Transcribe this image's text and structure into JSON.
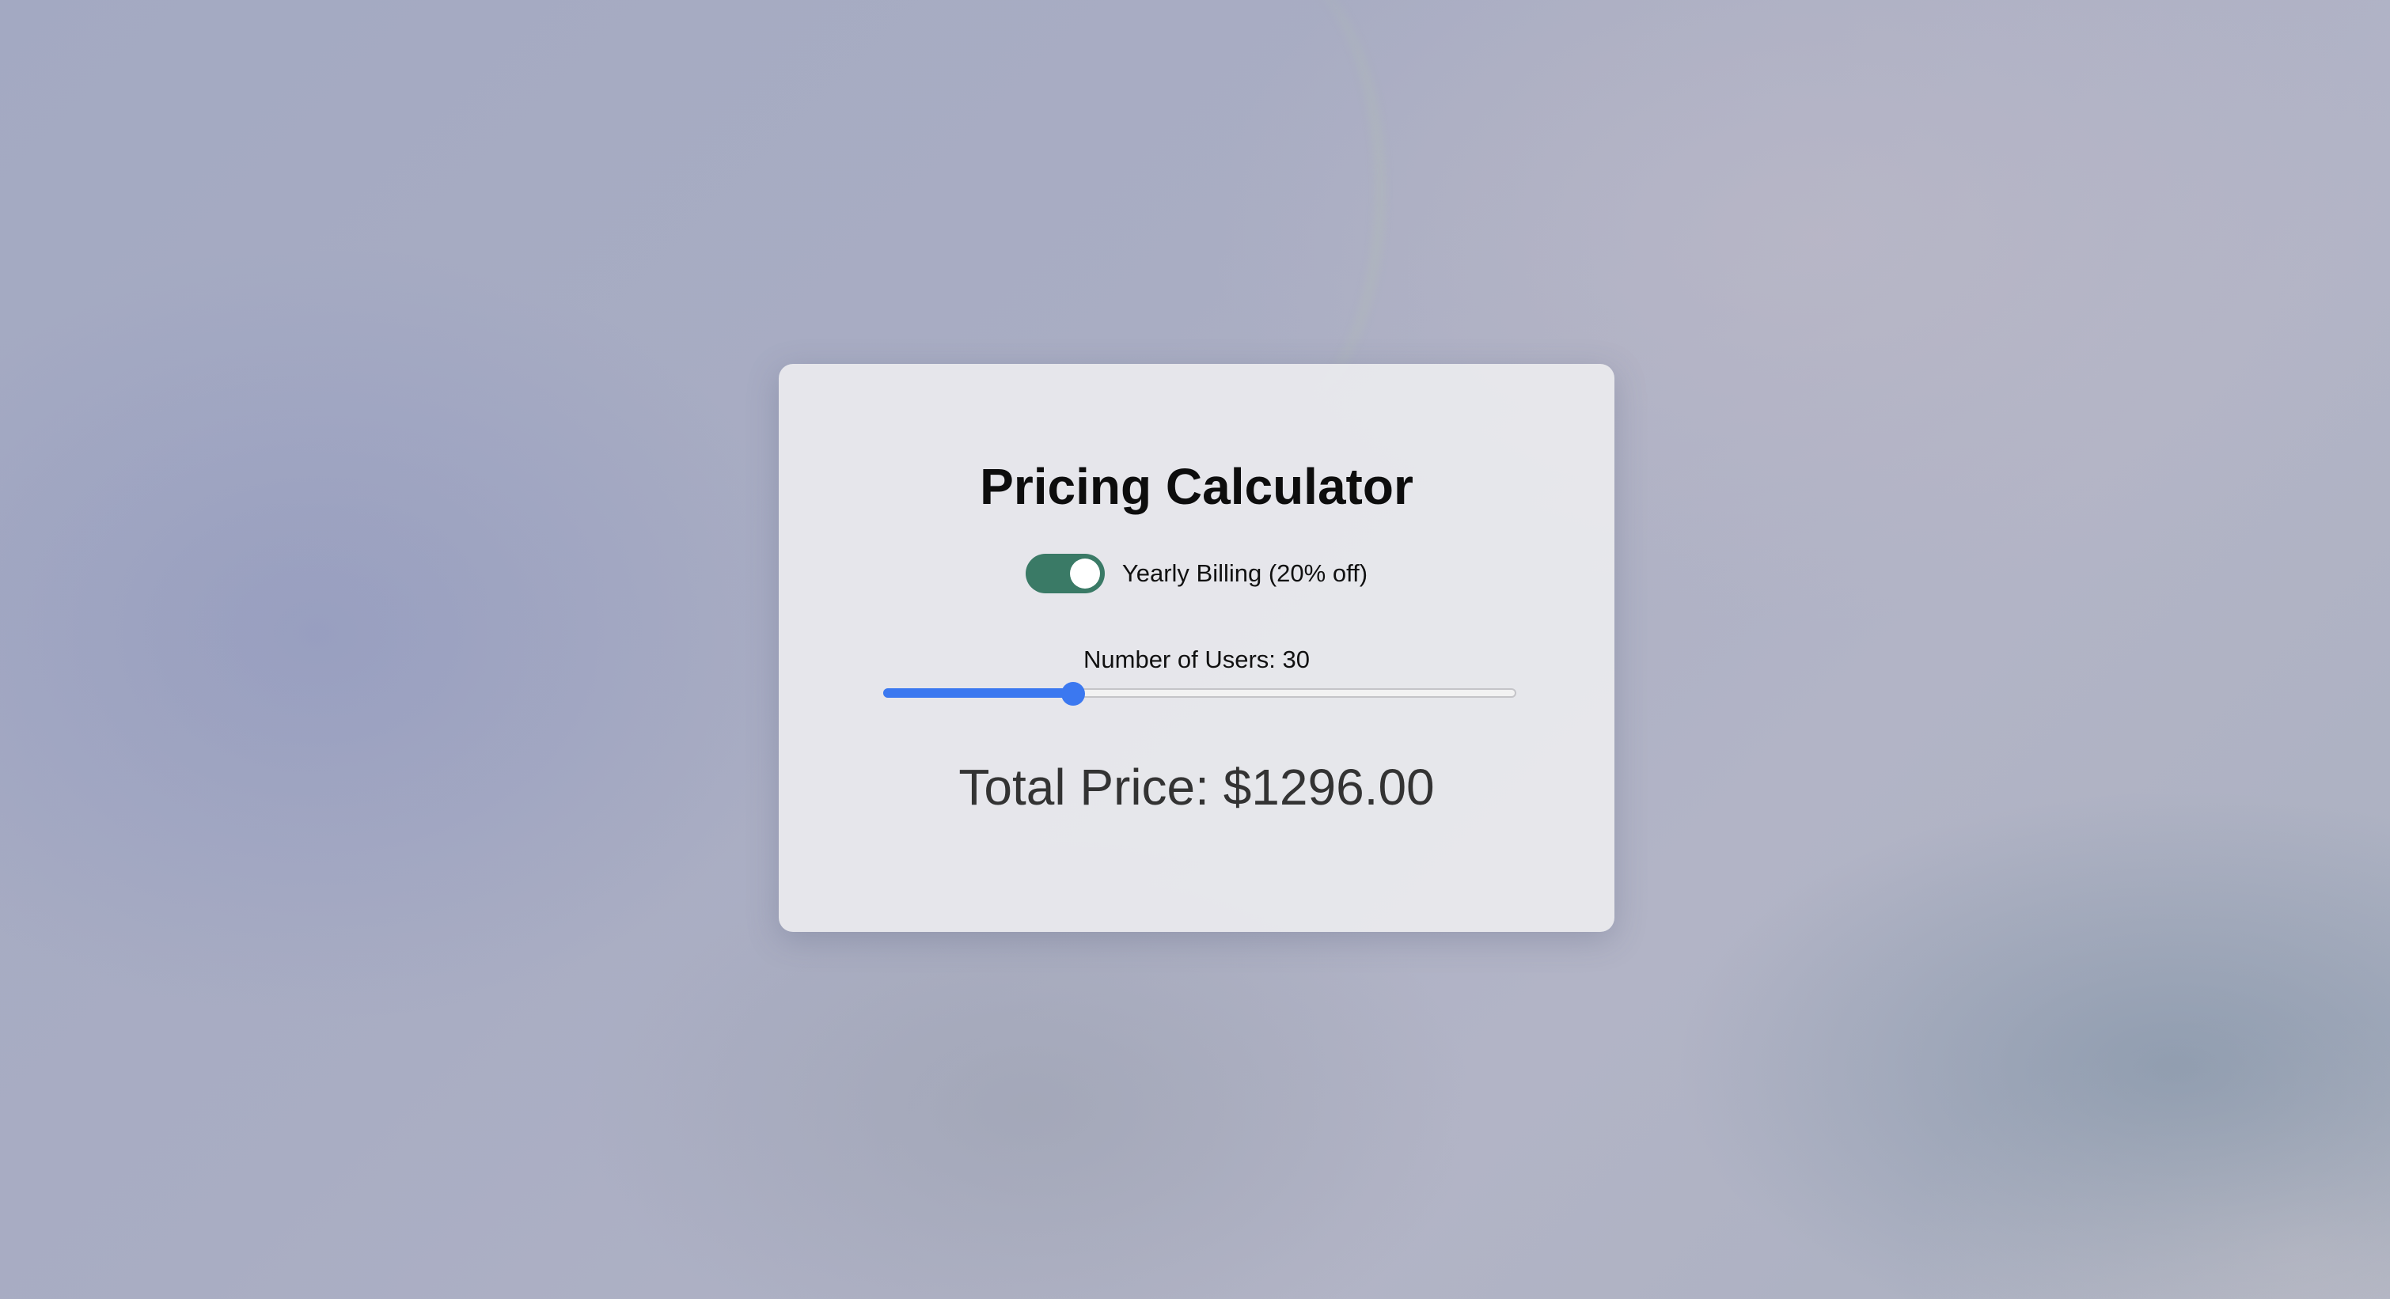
{
  "calculator": {
    "title": "Pricing Calculator",
    "billing_toggle": {
      "label": "Yearly Billing (20% off)",
      "checked": true,
      "color": "#3a7a66"
    },
    "users": {
      "label": "Number of Users: 30",
      "value": 30,
      "slider_fraction": 0.3,
      "accent_color": "#3b78f0"
    },
    "total_label": "Total Price: $1296.00"
  }
}
